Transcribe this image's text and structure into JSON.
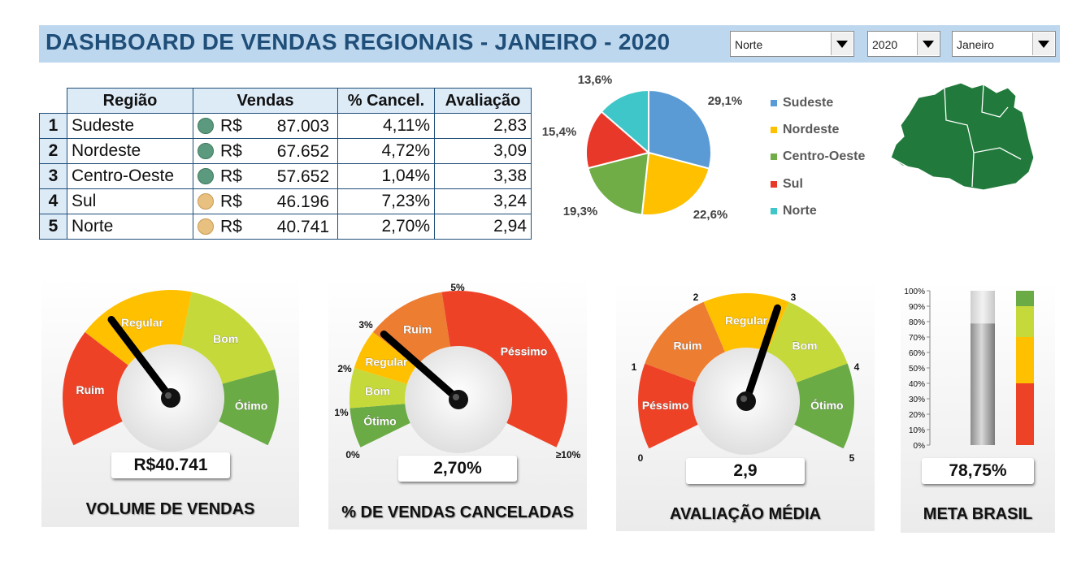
{
  "header": {
    "title": "DASHBOARD DE VENDAS REGIONAIS - JANEIRO - 2020"
  },
  "filters": {
    "regiao": {
      "value": "Norte",
      "icon": "chevron-down-icon"
    },
    "ano": {
      "value": "2020",
      "icon": "chevron-down-icon"
    },
    "mes": {
      "value": "Janeiro",
      "icon": "chevron-down-icon"
    }
  },
  "table": {
    "headers": [
      "Região",
      "Vendas",
      "% Cancel.",
      "Avaliação"
    ],
    "rows": [
      {
        "rank": "1",
        "regiao": "Sudeste",
        "moeda": "R$",
        "vendas": "87.003",
        "cancel": "4,11%",
        "aval": "2,83",
        "dot": "#5b9a7e"
      },
      {
        "rank": "2",
        "regiao": "Nordeste",
        "moeda": "R$",
        "vendas": "67.652",
        "cancel": "4,72%",
        "aval": "3,09",
        "dot": "#5b9a7e"
      },
      {
        "rank": "3",
        "regiao": "Centro-Oeste",
        "moeda": "R$",
        "vendas": "57.652",
        "cancel": "1,04%",
        "aval": "3,38",
        "dot": "#5b9a7e"
      },
      {
        "rank": "4",
        "regiao": "Sul",
        "moeda": "R$",
        "vendas": "46.196",
        "cancel": "7,23%",
        "aval": "3,24",
        "dot": "#e8c07f"
      },
      {
        "rank": "5",
        "regiao": "Norte",
        "moeda": "R$",
        "vendas": "40.741",
        "cancel": "2,70%",
        "aval": "2,94",
        "dot": "#e8c07f"
      }
    ]
  },
  "chart_data": [
    {
      "type": "pie",
      "categories": [
        "Sudeste",
        "Nordeste",
        "Centro-Oeste",
        "Sul",
        "Norte"
      ],
      "values": [
        29.1,
        22.6,
        19.3,
        15.4,
        13.6
      ],
      "labels": [
        "29,1%",
        "22,6%",
        "19,3%",
        "15,4%",
        "13,6%"
      ],
      "colors": [
        "#5b9bd5",
        "#ffc000",
        "#70ad47",
        "#e8382a",
        "#3ec6c8"
      ],
      "legend": "right"
    },
    {
      "type": "stacked-bar",
      "y_ticks": [
        "100%",
        "90%",
        "80%",
        "70%",
        "60%",
        "50%",
        "40%",
        "30%",
        "20%",
        "10%",
        "0%"
      ],
      "bands": [
        {
          "from": 0,
          "to": 40,
          "color": "#ee4227"
        },
        {
          "from": 40,
          "to": 70,
          "color": "#ffc000"
        },
        {
          "from": 70,
          "to": 90,
          "color": "#c5d93a"
        },
        {
          "from": 90,
          "to": 100,
          "color": "#6aab45"
        }
      ],
      "value": 78.75
    }
  ],
  "map": {
    "region": "Norte",
    "color": "#217a3c"
  },
  "gauges": {
    "volume": {
      "title": "VOLUME DE VENDAS",
      "readout": "R$40.741",
      "needle_fraction": 0.34,
      "zones": [
        {
          "label": "Ruim",
          "color": "#ee4227"
        },
        {
          "label": "Regular",
          "color": "#ffc000"
        },
        {
          "label": "Bom",
          "color": "#c5d93a"
        },
        {
          "label": "Ótimo",
          "color": "#6aab45"
        }
      ]
    },
    "cancel": {
      "title": "% DE VENDAS CANCELADAS",
      "readout": "2,70%",
      "ticks": [
        "0%",
        "1%",
        "2%",
        "3%",
        "5%",
        "≥10%"
      ],
      "needle_fraction": 0.29,
      "zones": [
        {
          "label": "Ótimo",
          "color": "#6aab45"
        },
        {
          "label": "Bom",
          "color": "#c5d93a"
        },
        {
          "label": "Regular",
          "color": "#ffc000"
        },
        {
          "label": "Ruim",
          "color": "#ed7d31"
        },
        {
          "label": "Péssimo",
          "color": "#ee4227"
        }
      ]
    },
    "avaliacao": {
      "title": "AVALIAÇÃO MÉDIA",
      "readout": "2,9",
      "ticks": [
        "0",
        "1",
        "2",
        "3",
        "4",
        "5"
      ],
      "needle_fraction": 0.58,
      "zones": [
        {
          "label": "Péssimo",
          "color": "#ee4227"
        },
        {
          "label": "Ruim",
          "color": "#ed7d31"
        },
        {
          "label": "Regular",
          "color": "#ffc000"
        },
        {
          "label": "Bom",
          "color": "#c5d93a"
        },
        {
          "label": "Ótimo",
          "color": "#6aab45"
        }
      ]
    },
    "meta": {
      "title": "META BRASIL",
      "readout": "78,75%"
    }
  }
}
